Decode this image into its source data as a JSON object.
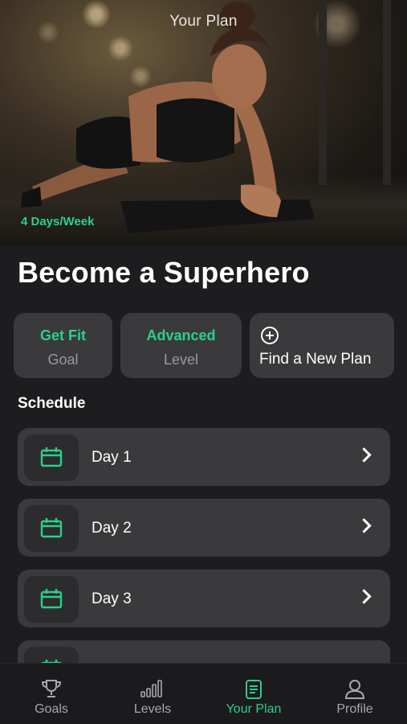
{
  "hero": {
    "title": "Your Plan",
    "frequency": "4 Days/Week"
  },
  "plan": {
    "title": "Become a Superhero"
  },
  "stats": [
    {
      "value": "Get Fit",
      "label": "Goal"
    },
    {
      "value": "Advanced",
      "label": "Level"
    }
  ],
  "find_plan": {
    "label": "Find a New Plan",
    "icon": "plus-circle-icon"
  },
  "schedule": {
    "heading": "Schedule",
    "days": [
      {
        "label": "Day 1",
        "icon": "calendar-icon"
      },
      {
        "label": "Day 2",
        "icon": "calendar-icon"
      },
      {
        "label": "Day 3",
        "icon": "calendar-icon"
      },
      {
        "label": "",
        "icon": "calendar-icon"
      }
    ]
  },
  "tabbar": {
    "tabs": [
      {
        "label": "Goals",
        "icon": "trophy-icon"
      },
      {
        "label": "Levels",
        "icon": "bar-chart-icon"
      },
      {
        "label": "Your Plan",
        "icon": "document-icon"
      },
      {
        "label": "Profile",
        "icon": "person-icon"
      }
    ],
    "active": "Your Plan"
  },
  "colors": {
    "accent": "#2bd08a",
    "background": "#1d1d1f",
    "card": "#3a3a3c",
    "muted_text": "#9a9a9e"
  }
}
